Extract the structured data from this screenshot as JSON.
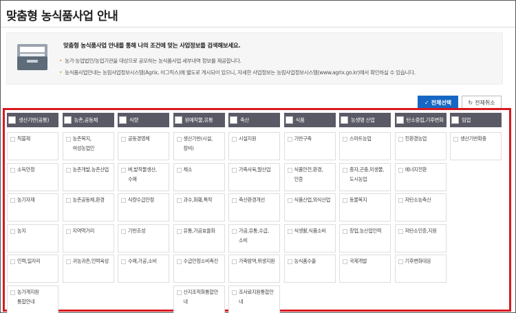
{
  "page": {
    "title": "맞춤형 농식품사업 안내"
  },
  "info": {
    "lead": "맞춤형 농식품사업 안내를 통해 나의 조건에 맞는 사업정보를 검색해보세요.",
    "bullets": [
      "농가·농업법인/농업기관을 대상으로 공모하는 농식품사업 세부내역 정보를 제공합니다.",
      "농식품사업안내는 농림사업정보시스템(Agrix, 아그릭스)에 별도로 게시되어 있으니, 자세한 사업정보는 농림사업정보시스템(www.agrix.go.kr)에서 확인하실 수 있습니다."
    ]
  },
  "buttons": {
    "select_all": "전체선택",
    "clear_all": "전체취소"
  },
  "colors": {
    "accent": "#1667c3",
    "highlight": "#d8171f",
    "header": "#5a5a66"
  },
  "categories": [
    {
      "name": "생산기반(공통)",
      "items": [
        "직불제",
        "소득안정",
        "농기자재",
        "농지",
        "인력,일자리",
        "농가계지원\n통합안내"
      ]
    },
    {
      "name": "농촌,공동체",
      "items": [
        "농촌복지,\n여성농업인",
        "농촌개발,농촌산업",
        "농촌공동체,환경",
        "지역먹거리",
        "귀농귀촌,인력육성"
      ]
    },
    {
      "name": "식량",
      "items": [
        "공동경영체",
        "벼,밭작물생산,\n수매",
        "식량수급안정",
        "기반조성",
        "수매,가공,소비"
      ]
    },
    {
      "name": "원예작물,유통",
      "items": [
        "생산기반(시설,\n장비)",
        "채소",
        "과수,화훼,특작",
        "유통,가공효율화",
        "수급안정소비촉진",
        "산지조직화통합안\n내"
      ]
    },
    {
      "name": "축산",
      "items": [
        "시설지원",
        "가축사육,말산업",
        "축산환경개선",
        "가공,유통,수급,\n소비",
        "가축방역,위생지원",
        "조사료지원통합안\n내"
      ]
    },
    {
      "name": "식품",
      "items": [
        "기반구축",
        "식품안전,환경,\n인증",
        "식품산업,외식산업",
        "식생활,식품소비",
        "농식품수출"
      ]
    },
    {
      "name": "농생명 산업",
      "items": [
        "스마트농업",
        "종자,곤충,미생물,\n도시농업",
        "동물복지",
        "창업,농산업인력",
        "국제개발"
      ]
    },
    {
      "name": "탄소중립,기후변화",
      "items": [
        "친환경농업",
        "에너지전환",
        "저탄소농축산",
        "저탄소인증,지원",
        "기후변화대응"
      ]
    },
    {
      "name": "임업",
      "items": [
        "생산기반확충"
      ]
    }
  ]
}
